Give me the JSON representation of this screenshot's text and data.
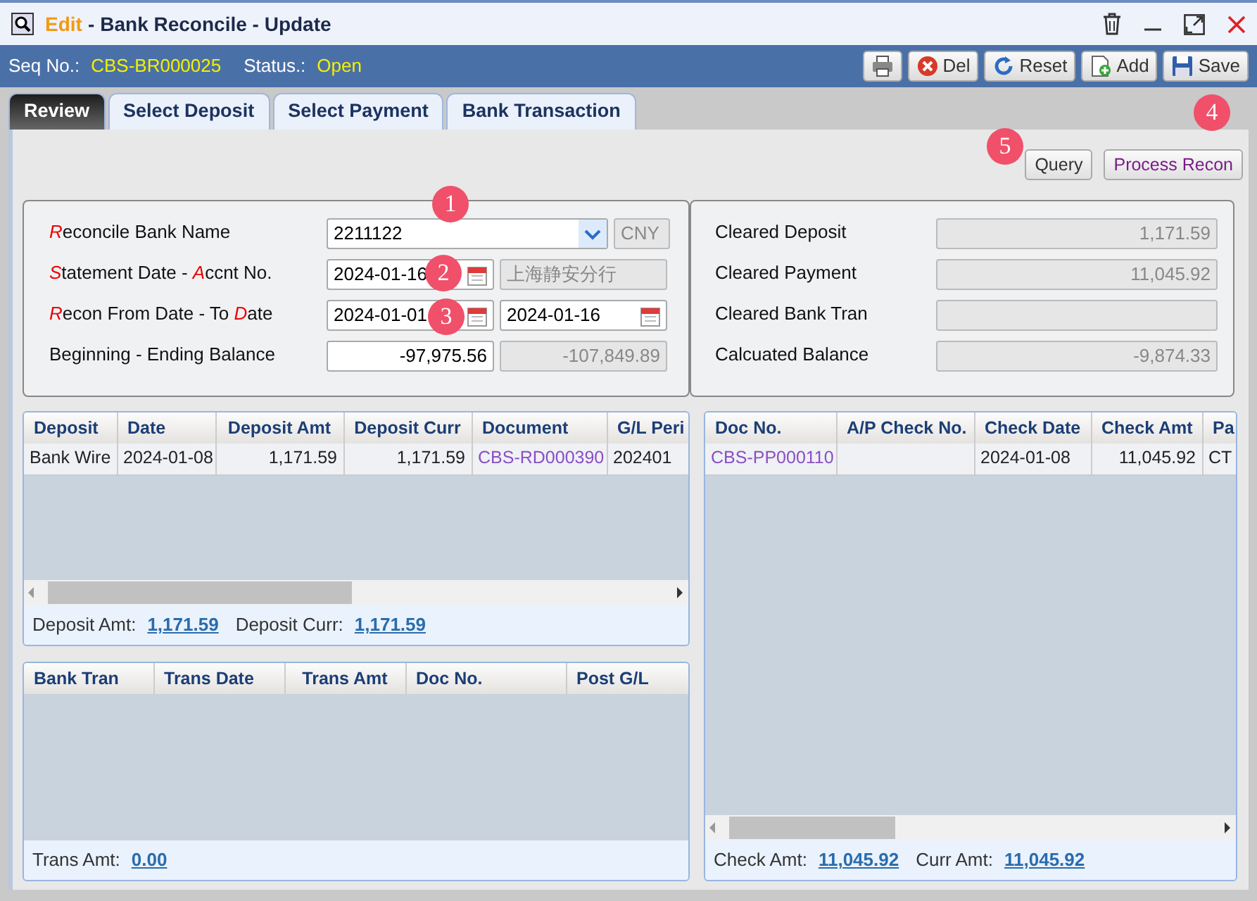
{
  "window": {
    "mode": "Edit",
    "separator": "-",
    "title": "Bank Reconcile - Update"
  },
  "record": {
    "seq_label": "Seq No.:",
    "seq": "CBS-BR000025",
    "status_label": "Status.:",
    "status": "Open"
  },
  "toolbar": [
    {
      "kind": "print"
    },
    {
      "kind": "delete",
      "label": "Del"
    },
    {
      "kind": "reset",
      "label": "Reset"
    },
    {
      "kind": "add",
      "label": "Add"
    },
    {
      "kind": "save",
      "label": "Save"
    }
  ],
  "tabs": [
    {
      "label": "Review",
      "selected": true
    },
    {
      "label": "Select Deposit",
      "selected": false
    },
    {
      "label": "Select Payment",
      "selected": false
    },
    {
      "label": "Bank Transaction",
      "selected": false
    }
  ],
  "actions": [
    {
      "label": "Query",
      "kind": "plain"
    },
    {
      "label": "Process Recon",
      "kind": "accent"
    }
  ],
  "form": [
    {
      "label": [
        {
          "text": "R",
          "kind": "required"
        },
        {
          "text": "econcile Bank Name",
          "kind": "plain"
        }
      ],
      "fields": [
        {
          "kind": "select",
          "value": "2211122",
          "readonly": false
        },
        {
          "kind": "code",
          "value": "CNY",
          "readonly": true
        }
      ]
    },
    {
      "label": [
        {
          "text": "S",
          "kind": "required"
        },
        {
          "text": "tatement Date - ",
          "kind": "plain"
        },
        {
          "text": "A",
          "kind": "required"
        },
        {
          "text": "ccnt No.",
          "kind": "plain"
        }
      ],
      "fields": [
        {
          "kind": "date",
          "value": "2024-01-16",
          "readonly": false
        },
        {
          "kind": "text",
          "value": "上海静安分行",
          "readonly": true
        }
      ]
    },
    {
      "label": [
        {
          "text": "R",
          "kind": "required"
        },
        {
          "text": "econ From Date - To ",
          "kind": "plain"
        },
        {
          "text": "D",
          "kind": "required"
        },
        {
          "text": "ate",
          "kind": "plain"
        }
      ],
      "fields": [
        {
          "kind": "date",
          "value": "2024-01-01",
          "readonly": false
        },
        {
          "kind": "date",
          "value": "2024-01-16",
          "readonly": false
        }
      ]
    },
    {
      "label": [
        {
          "text": "Beginning - Ending Balance",
          "kind": "plain"
        }
      ],
      "fields": [
        {
          "kind": "amount",
          "value": "-97,975.56",
          "readonly": false
        },
        {
          "kind": "amount",
          "value": "-107,849.89",
          "readonly": true
        }
      ]
    }
  ],
  "summary": [
    {
      "label": "Cleared Deposit",
      "value": "1,171.59"
    },
    {
      "label": "Cleared Payment",
      "value": "11,045.92"
    },
    {
      "label": "Cleared Bank Tran"
    },
    {
      "label": "Calcuated Balance",
      "value": "-9,874.33"
    }
  ],
  "deposit_table": {
    "columns": [
      {
        "label": "Deposit",
        "kind": "text"
      },
      {
        "label": "Date",
        "kind": "text"
      },
      {
        "label": "Deposit Amt",
        "kind": "amount"
      },
      {
        "label": "Deposit Curr",
        "kind": "amount"
      },
      {
        "label": "Document",
        "kind": "link"
      },
      {
        "label": "G/L Peri",
        "kind": "text"
      }
    ],
    "rows": [
      [
        "Bank Wire",
        "2024-01-08",
        "1,171.59",
        "1,171.59",
        "CBS-RD000390",
        "202401"
      ]
    ],
    "totals": [
      {
        "label": "Deposit Amt:",
        "value": "1,171.59"
      },
      {
        "label": "Deposit Curr:",
        "value": "1,171.59"
      }
    ]
  },
  "payment_table": {
    "columns": [
      {
        "label": "Doc No.",
        "kind": "link"
      },
      {
        "label": "A/P Check No.",
        "kind": "text"
      },
      {
        "label": "Check Date",
        "kind": "text"
      },
      {
        "label": "Check Amt",
        "kind": "amount"
      },
      {
        "label": "Pa",
        "kind": "text"
      }
    ],
    "rows": [
      [
        "CBS-PP000110",
        null,
        "2024-01-08",
        "11,045.92",
        "CT"
      ]
    ],
    "totals": [
      {
        "label": "Check Amt:",
        "value": "11,045.92"
      },
      {
        "label": "Curr Amt:",
        "value": "11,045.92"
      }
    ]
  },
  "bank_tran_table": {
    "columns": [
      {
        "label": "Bank Tran",
        "kind": "text"
      },
      {
        "label": "Trans Date",
        "kind": "text"
      },
      {
        "label": "Trans Amt",
        "kind": "amount"
      },
      {
        "label": "Doc No.",
        "kind": "text"
      },
      {
        "label": "Post G/L",
        "kind": "text"
      }
    ],
    "totals": [
      {
        "label": "Trans Amt:",
        "value": "0.00"
      }
    ]
  },
  "markers": [
    {
      "number": "1"
    },
    {
      "number": "2"
    },
    {
      "number": "3"
    },
    {
      "number": "4"
    },
    {
      "number": "5"
    }
  ]
}
